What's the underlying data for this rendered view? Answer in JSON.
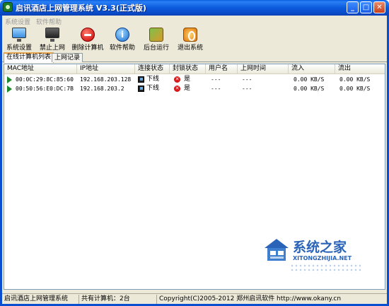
{
  "window": {
    "title": "启讯酒店上网管理系统 V3.3(正式版)",
    "controls": {
      "minimize": "_",
      "maximize": "□",
      "close": "✕"
    }
  },
  "menu": {
    "items": [
      "系统设置",
      "软件帮助"
    ]
  },
  "toolbar": {
    "buttons": [
      {
        "label": "系统设置",
        "icon": "monitor-settings-icon"
      },
      {
        "label": "禁止上网",
        "icon": "monitor-blocked-icon"
      },
      {
        "label": "删除计算机",
        "icon": "delete-icon"
      },
      {
        "label": "软件帮助",
        "icon": "help-icon"
      },
      {
        "label": "后台运行",
        "icon": "background-run-icon"
      },
      {
        "label": "退出系统",
        "icon": "exit-icon"
      }
    ]
  },
  "tabs": [
    {
      "label": "在线计算机列表",
      "active": true
    },
    {
      "label": "上网记录",
      "active": false
    }
  ],
  "list": {
    "columns": [
      "MAC地址",
      "IP地址",
      "连接状态",
      "封锁状态",
      "用户名",
      "上网时间",
      "流入",
      "流出"
    ],
    "rows": [
      {
        "mac": "00:0C:29:8C:85:60",
        "ip": "192.168.203.128",
        "conn": "下线",
        "block": "是",
        "user": "---",
        "time": "---",
        "in": "0.00 KB/S",
        "out": "0.00 KB/S"
      },
      {
        "mac": "00:50:56:E0:DC:7B",
        "ip": "192.168.203.2",
        "conn": "下线",
        "block": "是",
        "user": "---",
        "time": "---",
        "in": "0.00 KB/S",
        "out": "0.00 KB/S"
      }
    ]
  },
  "watermark": {
    "title": "系统之家",
    "url": "XITONGZHIJIA.NET"
  },
  "statusbar": {
    "app": "启讯酒店上网管理系统",
    "count": "共有计算机：2台",
    "copyright": "Copyright(C)2005-2012 郑州启讯软件 http://www.okany.cn"
  }
}
